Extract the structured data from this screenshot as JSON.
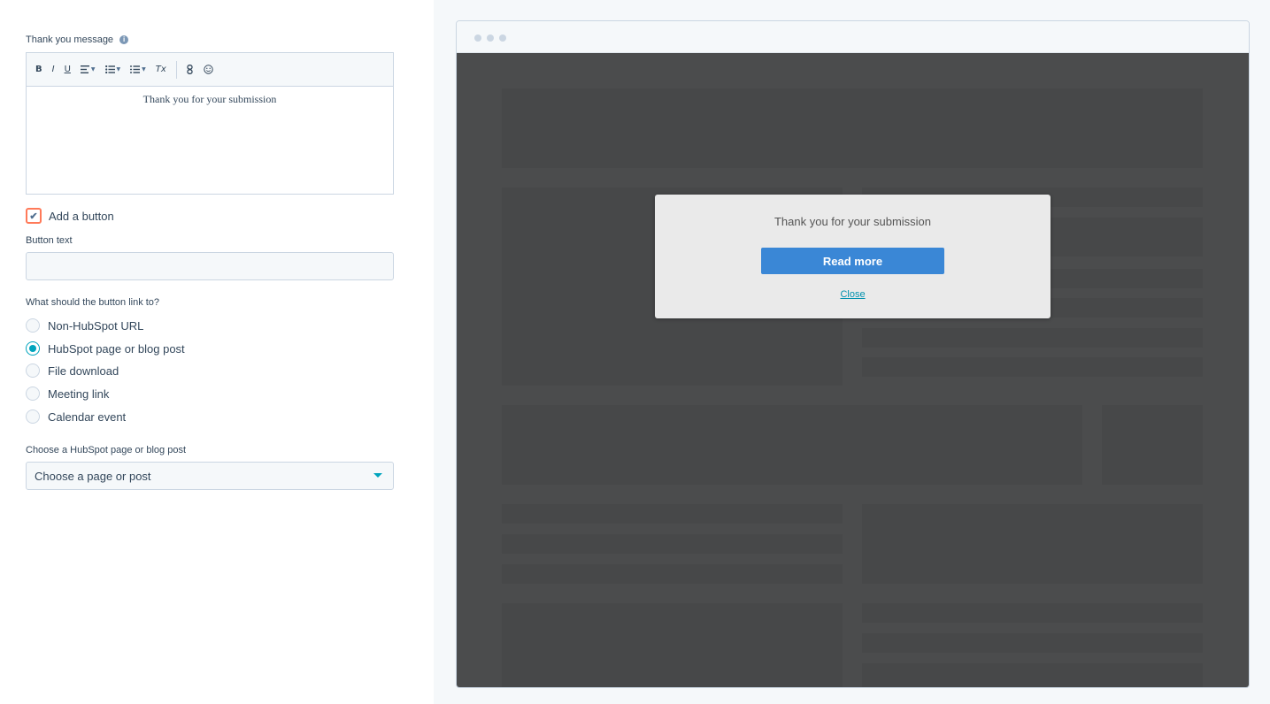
{
  "thank_you": {
    "label": "Thank you message",
    "info_icon": "i",
    "toolbar": {
      "bold": "B",
      "italic": "I",
      "underline": "U",
      "clear": "Tx"
    },
    "body_text": "Thank you for your submission"
  },
  "add_button": {
    "label": "Add a button",
    "checked": true
  },
  "button_text": {
    "label": "Button text",
    "value": ""
  },
  "link_to": {
    "label": "What should the button link to?",
    "options": [
      {
        "label": "Non-HubSpot URL",
        "selected": false
      },
      {
        "label": "HubSpot page or blog post",
        "selected": true
      },
      {
        "label": "File download",
        "selected": false
      },
      {
        "label": "Meeting link",
        "selected": false
      },
      {
        "label": "Calendar event",
        "selected": false
      }
    ]
  },
  "page_select": {
    "label": "Choose a HubSpot page or blog post",
    "value": "Choose a page or post"
  },
  "preview": {
    "message": "Thank you for your submission",
    "button_label": "Read more",
    "close_label": "Close"
  },
  "colors": {
    "accent": "#00a4bd",
    "highlight": "#ff7a59",
    "cta": "#3a87d6"
  }
}
